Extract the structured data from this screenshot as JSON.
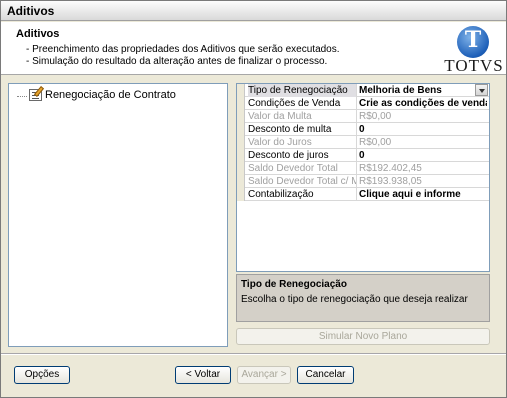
{
  "window": {
    "title": "Aditivos"
  },
  "header": {
    "title": "Aditivos",
    "line1": "- Preenchimento das propriedades dos Aditivos que serão executados.",
    "line2": "- Simulação do resultado da alteração antes de finalizar o processo.",
    "logo_text": "TOTVS",
    "logo_letter": "T"
  },
  "tree": {
    "items": [
      {
        "label": "Renegociação de Contrato",
        "icon": "edit-document-icon"
      }
    ]
  },
  "properties": [
    {
      "name": "Tipo de Renegociação",
      "value": "Melhoria de Bens",
      "enabled": true,
      "dropdown": true
    },
    {
      "name": "Condições de Venda",
      "value": "Crie as condições de venda",
      "enabled": true
    },
    {
      "name": "Valor da Multa",
      "value": "R$0,00",
      "enabled": false
    },
    {
      "name": "Desconto de multa",
      "value": "0",
      "enabled": true
    },
    {
      "name": "Valor do Juros",
      "value": "R$0,00",
      "enabled": false
    },
    {
      "name": "Desconto de juros",
      "value": "0",
      "enabled": true
    },
    {
      "name": "Saldo Devedor Total",
      "value": "R$192.402,45",
      "enabled": false
    },
    {
      "name": "Saldo Devedor Total c/ M. e",
      "value": "R$193.938,05",
      "enabled": false
    },
    {
      "name": "Contabilização",
      "value": "Clique aqui e informe",
      "enabled": true
    }
  ],
  "help": {
    "title": "Tipo de Renegociação",
    "text": "Escolha o tipo de renegociação que deseja realizar"
  },
  "simulate_button": "Simular Novo Plano",
  "footer": {
    "options": "Opções",
    "back": "< Voltar",
    "next": "Avançar >",
    "cancel": "Cancelar"
  },
  "colors": {
    "logo_blue": "#1d5fb8",
    "disabled_text": "#a0a0a0",
    "window_bg": "#ece9d8"
  }
}
